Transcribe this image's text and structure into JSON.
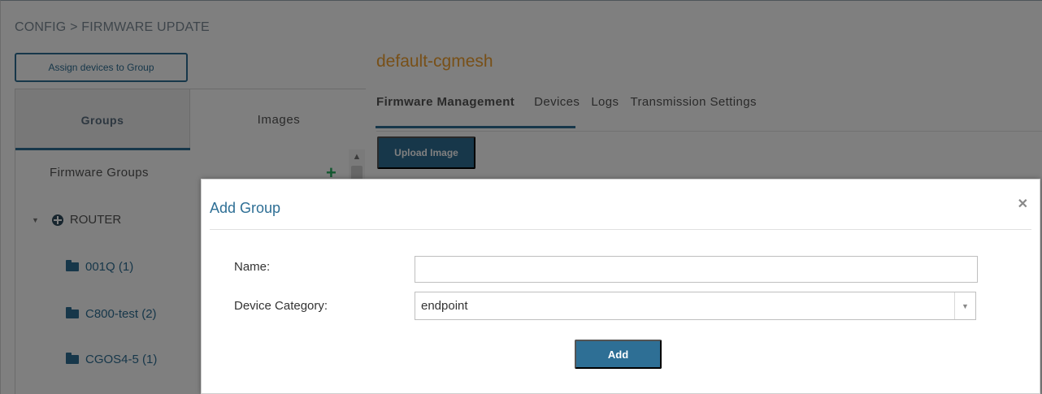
{
  "breadcrumb": "CONFIG > FIRMWARE UPDATE",
  "assign_button": "Assign devices to Group",
  "left_tabs": {
    "groups": "Groups",
    "images": "Images"
  },
  "firmware_groups_label": "Firmware Groups",
  "add_icon": "plus-icon",
  "tree": {
    "root": {
      "label": "ROUTER",
      "icon": "router-icon",
      "expanded": true
    },
    "items": [
      {
        "label": "001Q (1)",
        "icon": "folder-icon"
      },
      {
        "label": "C800-test (2)",
        "icon": "folder-icon"
      },
      {
        "label": "CGOS4-5 (1)",
        "icon": "folder-icon"
      }
    ]
  },
  "site_title": "default-cgmesh",
  "right_tabs": [
    {
      "label": "Firmware Management",
      "active": true
    },
    {
      "label": "Devices",
      "active": false
    },
    {
      "label": "Logs",
      "active": false
    },
    {
      "label": "Transmission Settings",
      "active": false
    }
  ],
  "upload_button": "Upload Image",
  "modal": {
    "title": "Add Group",
    "close_icon": "close-icon",
    "name_label": "Name:",
    "name_value": "",
    "category_label": "Device Category:",
    "category_value": "endpoint",
    "add_button": "Add"
  },
  "colors": {
    "accent": "#2e6f95",
    "site_title": "#f0a030",
    "plus": "#27ae60"
  }
}
